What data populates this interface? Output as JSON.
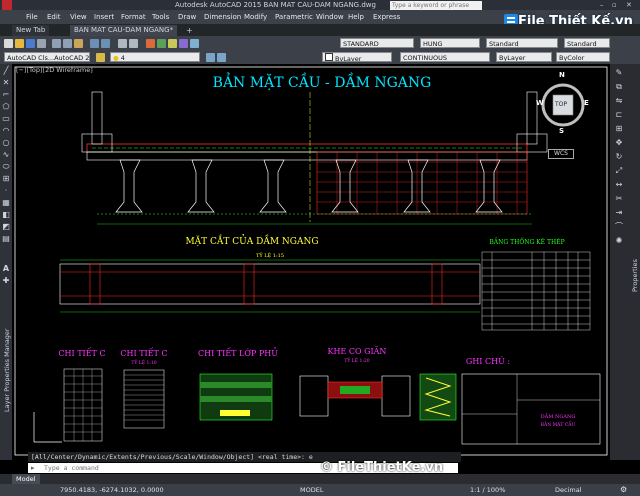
{
  "app": {
    "title": "Autodesk AutoCAD 2015    BAN MAT CAU-DAM NGANG.dwg",
    "search_placeholder": "Type a keyword or phrase"
  },
  "menu": [
    "File",
    "Edit",
    "View",
    "Insert",
    "Format",
    "Tools",
    "Draw",
    "Dimension",
    "Modify",
    "Parametric",
    "Window",
    "Help",
    "Express"
  ],
  "tabs": [
    {
      "label": "New Tab"
    },
    {
      "label": "BAN MAT CAU-DAM NGANG*"
    }
  ],
  "toolbar1": {
    "layer_value": "",
    "style1": "STANDARD",
    "style2": "HUNG",
    "style3": "Standard",
    "style4": "Standard"
  },
  "toolbar2": {
    "workspace": "AutoCAD Cls...AutoCAD 201",
    "layer_state": "4",
    "color": "ByLayer",
    "linetype": "CONTINUOUS",
    "lineweight": "ByLayer",
    "plotstyle": "ByColor"
  },
  "viewport": {
    "label": "[−][Top][2D Wireframe]"
  },
  "navcube": {
    "top_face": "TOP",
    "north": "N",
    "south": "S",
    "east": "E",
    "west": "W",
    "wcs": "WCS"
  },
  "drawing": {
    "title": "BẢN MẶT CẦU - DẦM NGANG",
    "section_title": "MẶT CẮT CỦA DẦM NGANG",
    "section_scale": "TỶ LỆ 1:15",
    "table_title": "BẢNG THỐNG KÊ THÉP",
    "detail_c1": "CHI TIẾT C",
    "detail_c2": "CHI TIẾT C",
    "detail_c2_scale": "TỶ LỆ 1:10",
    "detail_surface": "CHI TIẾT LỚP PHỦ",
    "joint": "KHE CO GIÃN",
    "joint_scale": "TỶ LỆ 1:20",
    "notes": "GHI CHÚ :",
    "titleblock_name": "DẦM NGANG",
    "titleblock_sub": "BẢN MẶT CẦU"
  },
  "side_labels": {
    "left": "Layer Properties Manager",
    "right": "Properties"
  },
  "command": {
    "history": "[All/Center/Dynamic/Extents/Previous/Scale/Window/Object] <real time>: e",
    "placeholder": "Type a command"
  },
  "model_tab": "Model",
  "status": {
    "coords": "7950.4183, -6274.1032, 0.0000",
    "model": "MODEL",
    "scale": "1:1 / 100%",
    "units": "Decimal"
  },
  "watermark": {
    "logo": "File Thiết Kế.vn",
    "footer": "© FileThietKe.vn"
  },
  "colors": {
    "canvas": "#000000",
    "title": "#00e5ff",
    "green": "#22ff22",
    "red": "#ff2a2a",
    "yellow": "#ffff33",
    "magenta": "#ff33ff"
  }
}
